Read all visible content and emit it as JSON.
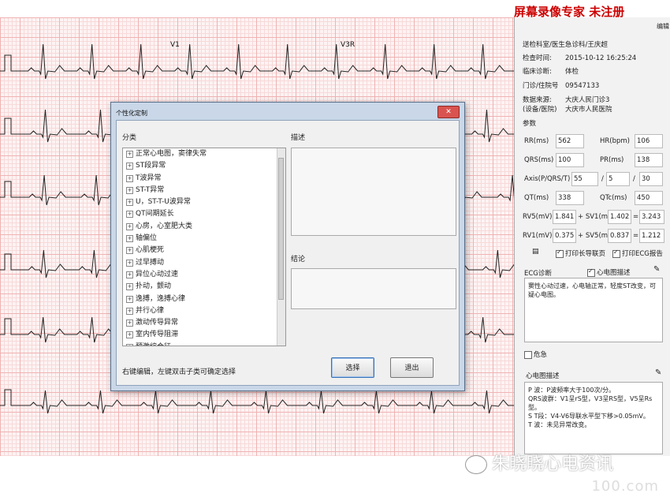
{
  "watermark_top": "屏幕录像专家  未注册",
  "right_panel": {
    "edit_label": "编辑",
    "info": [
      {
        "k": "送检科室/医生:",
        "v": "急诊科/王庆超"
      },
      {
        "k": "检查时间:",
        "v": "2015-10-12 16:25:24"
      },
      {
        "k": "临床诊断:",
        "v": "体检"
      },
      {
        "k": "门诊/住院号",
        "v": "09547133"
      },
      {
        "k": "数据来源:",
        "v": "大庆人民门诊3"
      },
      {
        "k": "(设备/医院)",
        "v": "大庆市人民医院"
      }
    ],
    "params_label": "参数",
    "params": {
      "rr_label": "RR(ms)",
      "rr": "562",
      "hr_label": "HR(bpm)",
      "hr": "106",
      "qrs_label": "QRS(ms)",
      "qrs": "100",
      "pr_label": "PR(ms)",
      "pr": "138",
      "axis_label": "Axis(P/QRS/T)",
      "axis_p": "55",
      "axis_qrs": "5",
      "axis_t": "30",
      "qt_label": "QT(ms)",
      "qt": "338",
      "qtc_label": "QTc(ms)",
      "qtc": "450",
      "rv5_label": "RV5(mV)",
      "rv5": "1.841",
      "sv1_label": "+ SV1(mV)",
      "sv1": "1.402",
      "rv5sv1": "3.243",
      "rv1_label": "RV1(mV)",
      "rv1": "0.375",
      "sv5_label": "+ SV5(mV)",
      "sv5": "0.837",
      "rv1sv5": "1.212"
    },
    "print_long_label": "打印长导联页",
    "print_ecg_label": "打印ECG报告",
    "diag_label": "ECG诊断",
    "desc_check_label": "心电图描述",
    "diag_text": "窦性心动过速，心电轴正常，轻度ST改变，可疑心电图。",
    "danger_label": "危急",
    "desc_label": "心电图描述",
    "desc_lines": [
      "P   波：P波频率大于100次/分。",
      "QRS波群：V1呈rS型，V3呈RS型，V5呈Rs型。",
      "S  T段：V4-V6导联水平型下移>0.05mV。",
      "T   波：未见异常改变。"
    ]
  },
  "leads": {
    "v1": "V1",
    "v3r": "V3R"
  },
  "dialog": {
    "title": "个性化定制",
    "category_label": "分类",
    "description_label": "描述",
    "conclusion_label": "结论",
    "tree_items": [
      "正常心电图，窦律失常",
      "ST段异常",
      "T波异常",
      "ST-T异常",
      "U，ST-T-U波异常",
      "QT间期延长",
      "心房，心室肥大类",
      "轴偏位",
      "心肌梗死",
      "过早搏动",
      "异位心动过速",
      "扑动，颤动",
      "逸搏，逸搏心律",
      "并行心律",
      "激动传导异常",
      "室内传导阻滞",
      "预激综合征"
    ],
    "hint": "右键编辑，左键双击子类可确定选择",
    "select_button": "选择",
    "exit_button": "退出"
  },
  "footer": {
    "wechat_name": "朱晓晓心电资讯",
    "site": "100.com"
  }
}
